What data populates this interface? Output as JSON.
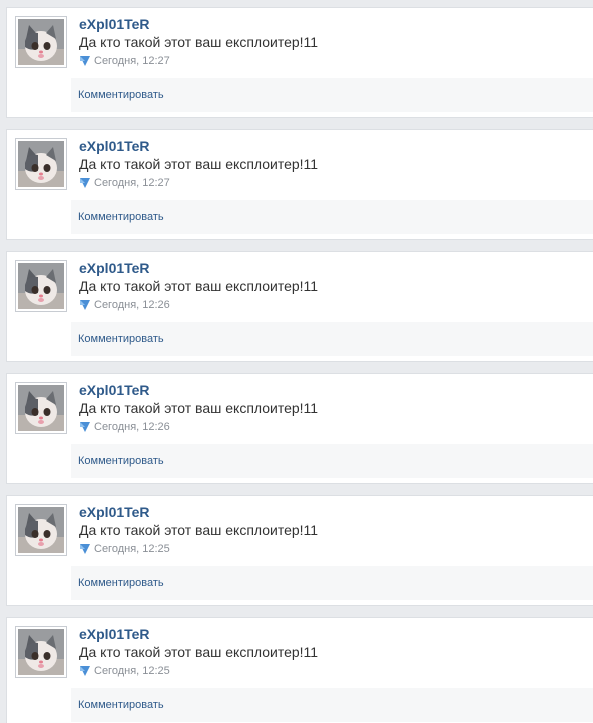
{
  "posts": [
    {
      "author": "eXpl01TeR",
      "text": "Да кто такой этот ваш експлоитер!11",
      "time": "Сегодня, 12:27",
      "comment_label": "Комментировать"
    },
    {
      "author": "eXpl01TeR",
      "text": "Да кто такой этот ваш експлоитер!11",
      "time": "Сегодня, 12:27",
      "comment_label": "Комментировать"
    },
    {
      "author": "eXpl01TeR",
      "text": "Да кто такой этот ваш експлоитер!11",
      "time": "Сегодня, 12:26",
      "comment_label": "Комментировать"
    },
    {
      "author": "eXpl01TeR",
      "text": "Да кто такой этот ваш експлоитер!11",
      "time": "Сегодня, 12:26",
      "comment_label": "Комментировать"
    },
    {
      "author": "eXpl01TeR",
      "text": "Да кто такой этот ваш експлоитер!11",
      "time": "Сегодня, 12:25",
      "comment_label": "Комментировать"
    },
    {
      "author": "eXpl01TeR",
      "text": "Да кто такой этот ваш експлоитер!11",
      "time": "Сегодня, 12:25",
      "comment_label": "Комментировать"
    }
  ],
  "icons": {
    "avatar": "kitten-avatar",
    "meta": "blue-triangle-icon"
  },
  "colors": {
    "author_link": "#2f5a8a",
    "meta_text": "#8a8f96",
    "meta_icon": "#4a8fd6"
  }
}
